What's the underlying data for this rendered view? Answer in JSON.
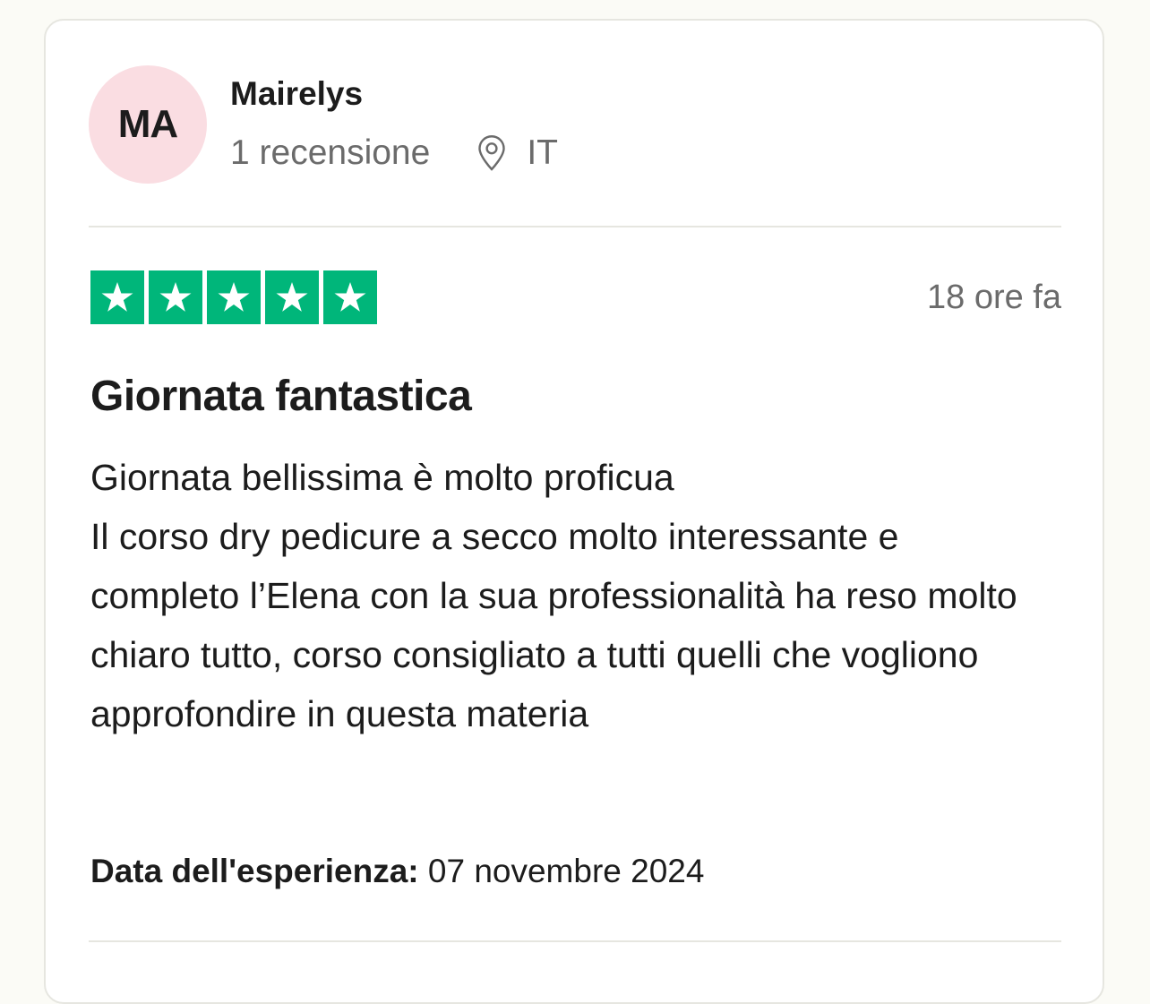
{
  "reviewer": {
    "initials": "MA",
    "name": "Mairelys",
    "review_count": "1 recensione",
    "country": "IT"
  },
  "review": {
    "rating": 5,
    "rating_max": 5,
    "time_ago": "18 ore fa",
    "title": "Giornata fantastica",
    "body": "Giornata bellissima è molto proficua\nIl corso dry pedicure a secco molto interessante e completo l’Elena con la sua professionalità ha reso molto chiaro tutto, corso consigliato a tutti quelli che vogliono approfondire in questa materia",
    "experience_label": "Data dell'esperienza:",
    "experience_date": "07 novembre 2024"
  },
  "colors": {
    "star_green": "#00b67a",
    "avatar_bg": "#fadde2"
  },
  "icons": {
    "location": "location-pin-icon",
    "star": "star-icon"
  }
}
